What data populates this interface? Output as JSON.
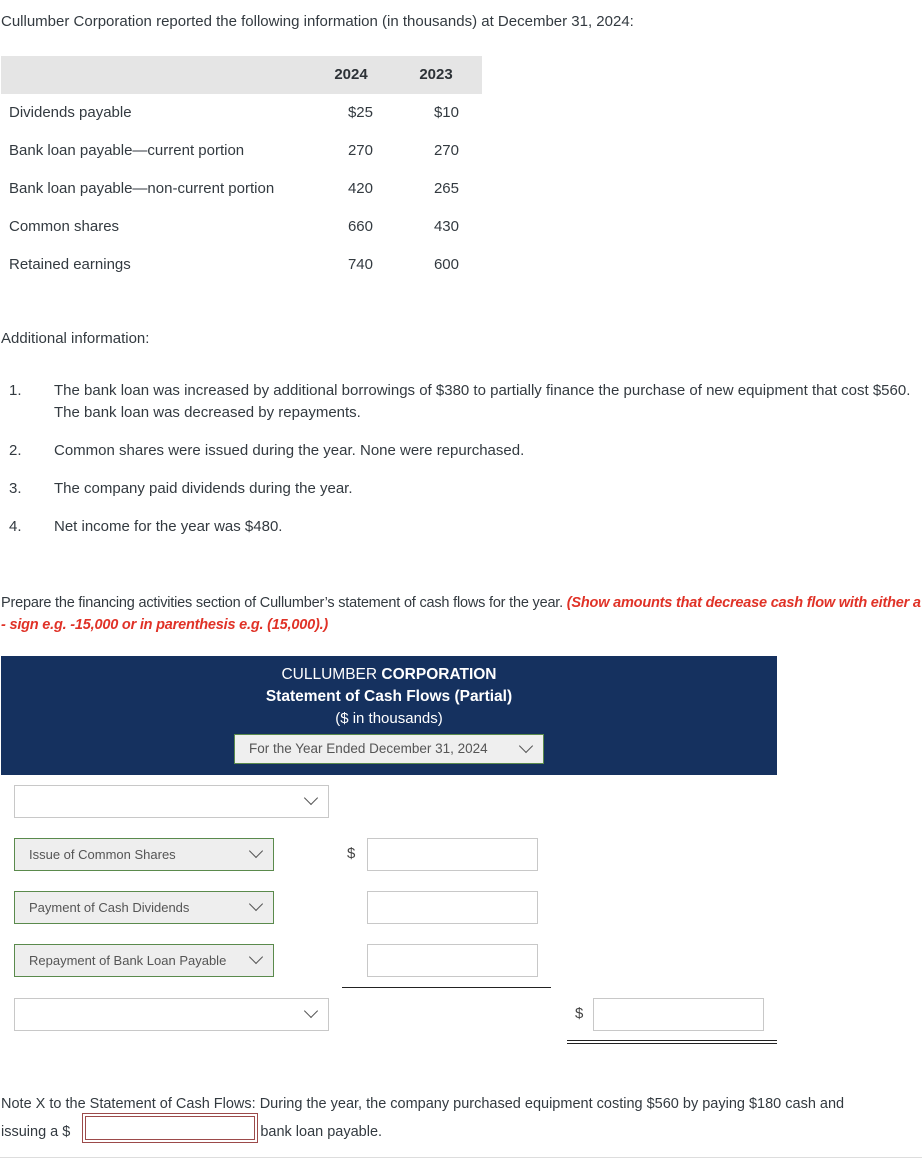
{
  "intro": "Cullumber Corporation reported the following information (in thousands) at December 31, 2024:",
  "table": {
    "columns": [
      "2024",
      "2023"
    ],
    "rows": [
      {
        "label": "Dividends payable",
        "y2024": "$25",
        "y2023": "$10"
      },
      {
        "label": "Bank loan payable—current portion",
        "y2024": "270",
        "y2023": "270"
      },
      {
        "label": "Bank loan payable—non-current portion",
        "y2024": "420",
        "y2023": "265"
      },
      {
        "label": "Common shares",
        "y2024": "660",
        "y2023": "430"
      },
      {
        "label": "Retained earnings",
        "y2024": "740",
        "y2023": "600"
      }
    ]
  },
  "additional": {
    "heading": "Additional information:",
    "items": [
      {
        "num": "1.",
        "text": "The bank loan was increased by additional borrowings of $380 to partially finance the purchase of new equipment that cost $560. The bank loan was decreased by repayments."
      },
      {
        "num": "2.",
        "text": "Common shares were issued during the year. None were repurchased."
      },
      {
        "num": "3.",
        "text": "The company paid dividends during the year."
      },
      {
        "num": "4.",
        "text": "Net income for the year was $480."
      }
    ]
  },
  "prompt": {
    "text": "Prepare the financing activities section of Cullumber’s statement of cash flows for the year. ",
    "instruction": "(Show amounts that decrease cash flow with either a - sign e.g. -15,000 or in parenthesis e.g. (15,000).)"
  },
  "statement": {
    "company_normal": "CULLUMBER ",
    "company_bold": "CORPORATION",
    "title": "Statement of Cash Flows (Partial)",
    "units": "($ in thousands)",
    "period_selected": "For the Year Ended December 31, 2024",
    "header_select": "",
    "lines": [
      {
        "label": "Issue of Common Shares",
        "amount": ""
      },
      {
        "label": "Payment of Cash Dividends",
        "amount": ""
      },
      {
        "label": "Repayment of Bank Loan Payable",
        "amount": ""
      }
    ],
    "total_select": "",
    "total_amount": "",
    "currency_symbol": "$"
  },
  "note": {
    "text1": "Note X to the Statement of Cash Flows: During the year, the company purchased equipment costing $560 by paying $180 cash and",
    "text2_before": "issuing a $",
    "input_value": "",
    "text2_after": "bank loan payable."
  },
  "colors": {
    "panel_bg": "#15315f",
    "instruction_red": "#e03227",
    "selected_border": "#5a8a4c",
    "note_input_border": "#9c4a4a"
  }
}
